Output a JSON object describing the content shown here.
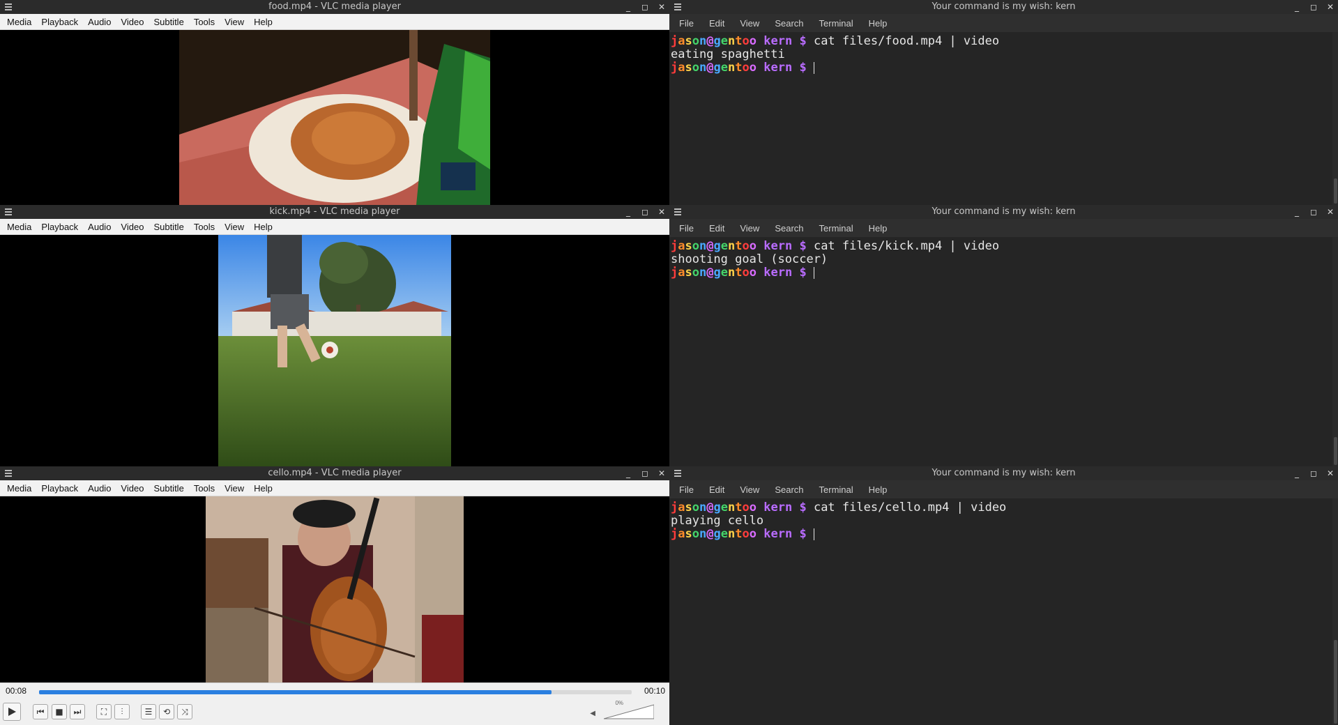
{
  "vlc_menu": [
    "Media",
    "Playback",
    "Audio",
    "Video",
    "Subtitle",
    "Tools",
    "View",
    "Help"
  ],
  "term_menu": [
    "File",
    "Edit",
    "View",
    "Search",
    "Terminal",
    "Help"
  ],
  "vlc_windows": [
    {
      "title": "food.mp4 - VLC media player",
      "label": "food"
    },
    {
      "title": "kick.mp4 - VLC media player",
      "label": "kick"
    },
    {
      "title": "cello.mp4 - VLC media player",
      "label": "cello"
    }
  ],
  "terminals": [
    {
      "title": "Your command is my wish: kern",
      "command": "cat files/food.mp4 | video",
      "output": "eating spaghetti"
    },
    {
      "title": "Your command is my wish: kern",
      "command": "cat files/kick.mp4 | video",
      "output": "shooting goal (soccer)"
    },
    {
      "title": "Your command is my wish: kern",
      "command": "cat files/cello.mp4 | video",
      "output": "playing cello"
    }
  ],
  "prompt": {
    "user": "jason",
    "host": "gentoo",
    "dir": "kern",
    "symbol": "$"
  },
  "player": {
    "elapsed": "00:08",
    "total": "00:10",
    "progress": 0.865,
    "volume_label": "0%"
  },
  "icons": {
    "close": "close-icon",
    "maximize": "maximize-icon",
    "minimize": "minimize-icon",
    "menu": "hamburger-icon"
  }
}
